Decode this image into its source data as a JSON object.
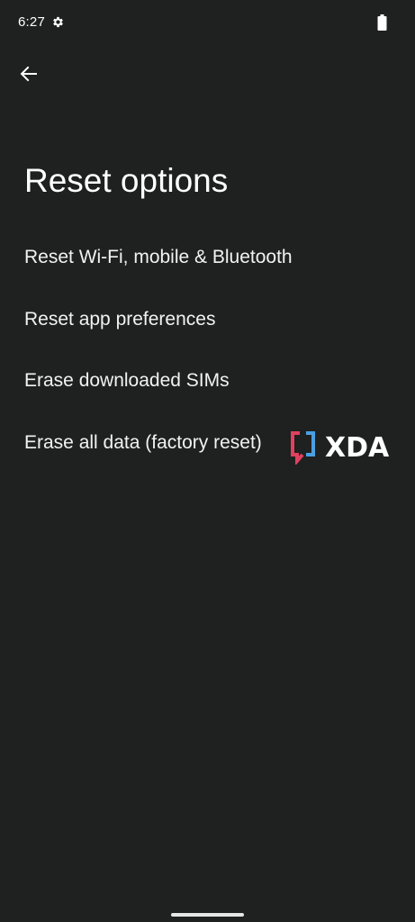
{
  "status_bar": {
    "time": "6:27",
    "icons": [
      "gear-icon",
      "battery-icon"
    ]
  },
  "header": {
    "back_icon": "arrow-left-icon"
  },
  "page": {
    "title": "Reset options"
  },
  "options": [
    {
      "label": "Reset Wi-Fi, mobile & Bluetooth"
    },
    {
      "label": "Reset app preferences"
    },
    {
      "label": "Erase downloaded SIMs"
    },
    {
      "label": "Erase all data (factory reset)"
    }
  ],
  "watermark": {
    "text": "XDA",
    "bracket_left_color": "#e0415f",
    "bracket_right_color": "#4a9fe0",
    "text_color": "#ffffff"
  },
  "colors": {
    "background": "#1f2020",
    "text": "#ffffff"
  }
}
